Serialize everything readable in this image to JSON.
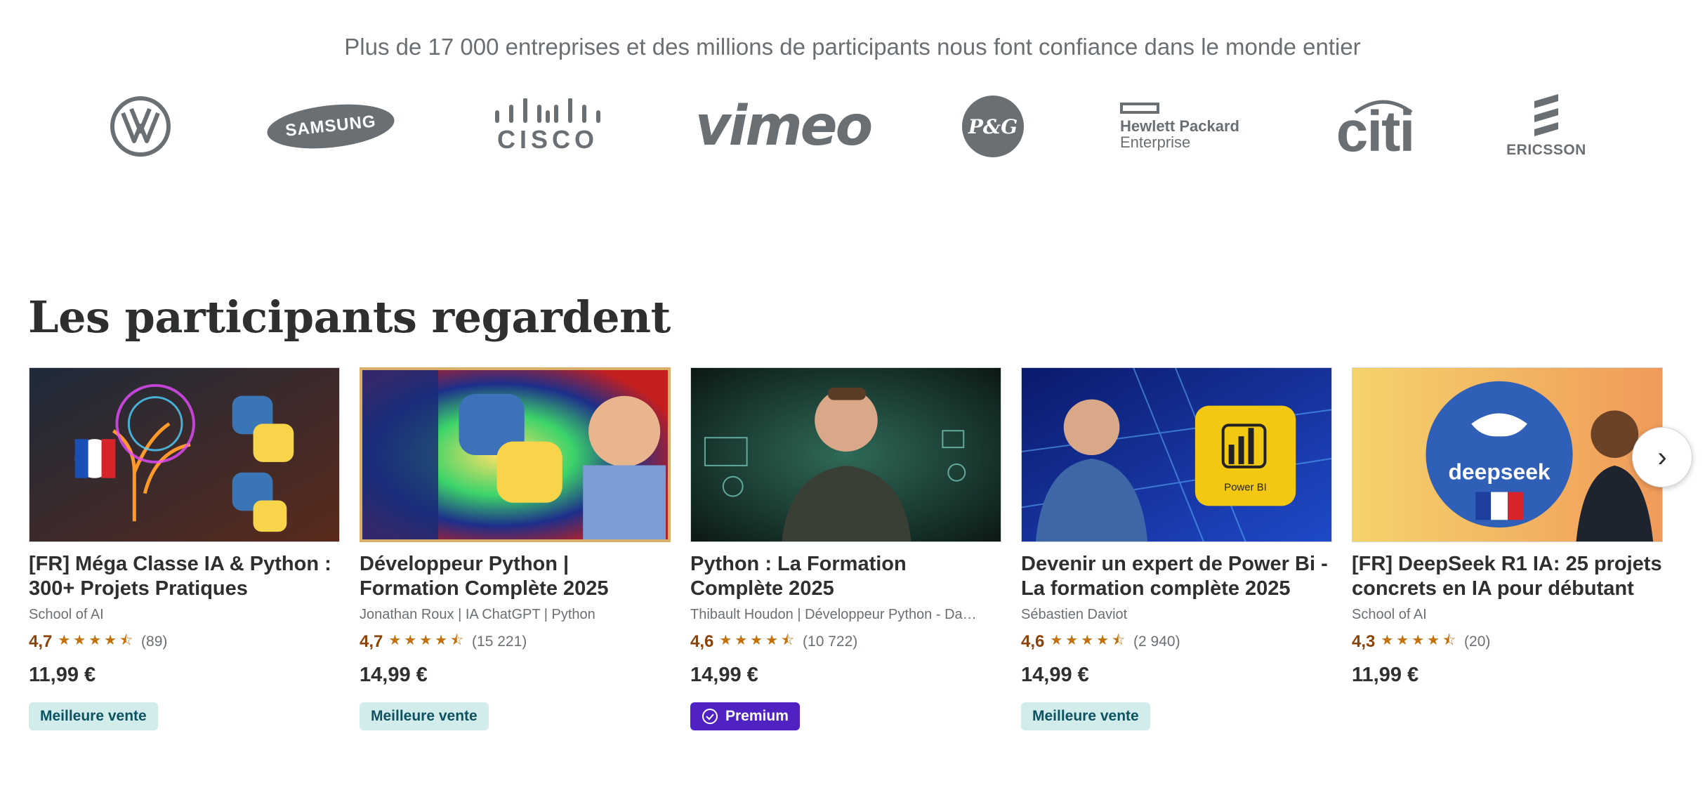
{
  "trust": {
    "title": "Plus de 17 000 entreprises et des millions de participants nous font confiance dans le monde entier",
    "logos": {
      "volkswagen": "VW",
      "samsung": "SAMSUNG",
      "cisco": "CISCO",
      "vimeo": "vimeo",
      "pg": "P&G",
      "hpe_line1": "Hewlett Packard",
      "hpe_line2": "Enterprise",
      "citi": "citi",
      "ericsson": "ERICSSON",
      "deepseek_thumb": "deepseek",
      "powerbi_thumb": "Power BI"
    }
  },
  "section": {
    "title": "Les participants regardent"
  },
  "courses": [
    {
      "title": "[FR] Méga Classe IA & Python : 300+ Projets Pratiques",
      "author": "School of AI",
      "rating": "4,7",
      "stars": "★★★★⯪",
      "count": "(89)",
      "price": "11,99 €",
      "badge": "Meilleure vente"
    },
    {
      "title": "Développeur Python | Formation Complète 2025",
      "author": "Jonathan Roux | IA ChatGPT | Python",
      "rating": "4,7",
      "stars": "★★★★⯪",
      "count": "(15 221)",
      "price": "14,99 €",
      "badge": "Meilleure vente"
    },
    {
      "title": "Python : La Formation Complète 2025",
      "author": "Thibault Houdon | Développeur Python - Da…",
      "rating": "4,6",
      "stars": "★★★★⯪",
      "count": "(10 722)",
      "price": "14,99 €",
      "badge": "Premium"
    },
    {
      "title": "Devenir un expert de Power Bi - La formation complète 2025",
      "author": "Sébastien Daviot",
      "rating": "4,6",
      "stars": "★★★★⯪",
      "count": "(2 940)",
      "price": "14,99 €",
      "badge": "Meilleure vente"
    },
    {
      "title": "[FR] DeepSeek R1 IA: 25 projets concrets en IA pour débutant",
      "author": "School of AI",
      "rating": "4,3",
      "stars": "★★★★⯪",
      "count": "(20)",
      "price": "11,99 €",
      "badge": ""
    }
  ],
  "carousel": {
    "next_icon": "chevron-right-icon",
    "next_glyph": "›"
  },
  "colors": {
    "rating": "#8b4309",
    "stars": "#c4710d",
    "badge_best_bg": "#d2ecec",
    "badge_premium_bg": "#5022c3"
  }
}
